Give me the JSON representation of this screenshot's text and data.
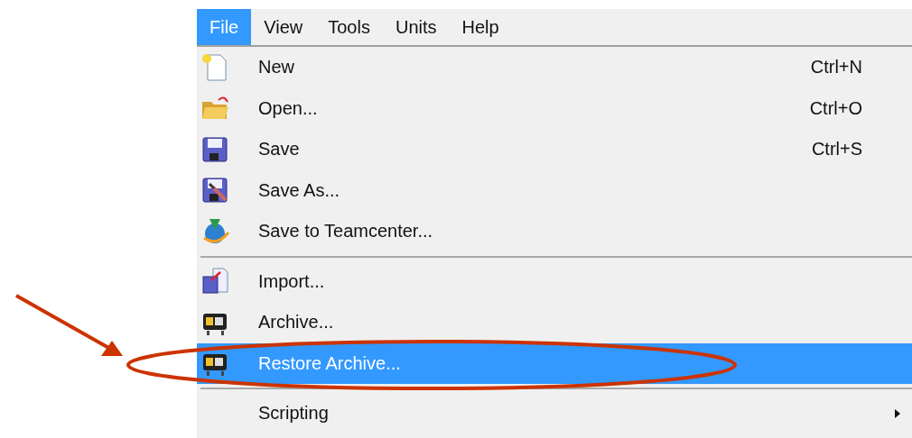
{
  "menu_bar": [
    {
      "label": "File",
      "selected": true
    },
    {
      "label": "View",
      "selected": false
    },
    {
      "label": "Tools",
      "selected": false
    },
    {
      "label": "Units",
      "selected": false
    },
    {
      "label": "Help",
      "selected": false
    }
  ],
  "menu": [
    {
      "kind": "item",
      "label": "New",
      "shortcut": "Ctrl+N",
      "selected": false
    },
    {
      "kind": "item",
      "label": "Open...",
      "shortcut": "Ctrl+O",
      "selected": false
    },
    {
      "kind": "item",
      "label": "Save",
      "shortcut": "Ctrl+S",
      "selected": false
    },
    {
      "kind": "item",
      "label": "Save As...",
      "selected": false
    },
    {
      "kind": "item",
      "label": "Save to Teamcenter...",
      "selected": false
    },
    {
      "kind": "separator"
    },
    {
      "kind": "item",
      "label": "Import...",
      "selected": false
    },
    {
      "kind": "item",
      "label": "Archive...",
      "selected": false
    },
    {
      "kind": "item",
      "label": "Restore Archive...",
      "selected": true
    },
    {
      "kind": "separator"
    },
    {
      "kind": "item",
      "label": "Scripting",
      "selected": false,
      "submenu": true
    }
  ]
}
